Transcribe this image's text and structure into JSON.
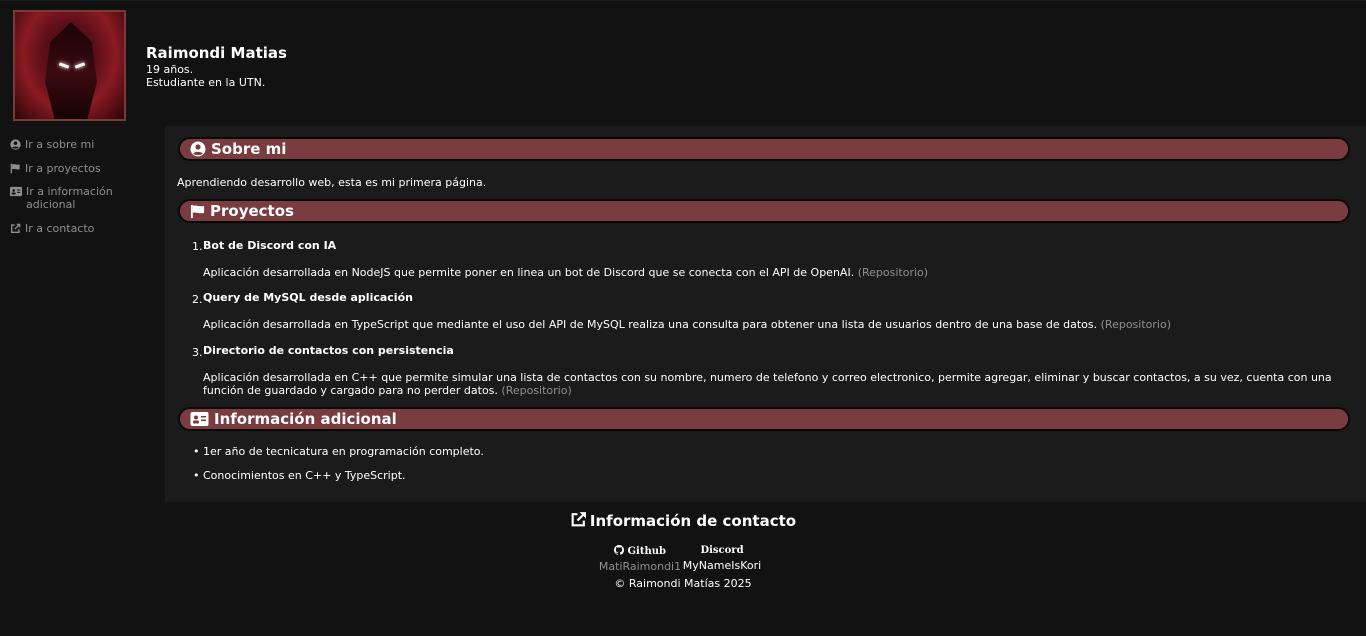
{
  "profile": {
    "name": "Raimondi Matias",
    "age": "19 años.",
    "description": "Estudiante en la UTN."
  },
  "sidebar": {
    "items": [
      {
        "label": "Ir a sobre mi",
        "icon": "user-circle-icon"
      },
      {
        "label": "Ir a proyectos",
        "icon": "flag-icon"
      },
      {
        "label": "Ir a información adicional",
        "icon": "id-card-icon"
      },
      {
        "label": "Ir a contacto",
        "icon": "external-link-icon"
      }
    ]
  },
  "about": {
    "title": "Sobre mi",
    "text": "Aprendiendo desarrollo web, esta es mi primera página."
  },
  "projects": {
    "title": "Proyectos",
    "items": [
      {
        "number": "1.",
        "title": "Bot de Discord con IA",
        "description": "Aplicación desarrollada en NodeJS que permite poner en linea un bot de Discord que se conecta con el API de OpenAI.",
        "link": "(Repositorio)"
      },
      {
        "number": "2.",
        "title": "Query de MySQL desde aplicación",
        "description": "Aplicación desarrollada en TypeScript que mediante el uso del API de MySQL realiza una consulta para obtener una lista de usuarios dentro de una base de datos.",
        "link": "(Repositorio)"
      },
      {
        "number": "3.",
        "title": "Directorio de contactos con persistencia",
        "description": "Aplicación desarrollada en C++ que permite simular una lista de contactos con su nombre, numero de telefono y correo electronico, permite agregar, eliminar y buscar contactos, a su vez, cuenta con una función de guardado y cargado para no perder datos.",
        "link": "(Repositorio)"
      }
    ]
  },
  "additional": {
    "title": "Información adicional",
    "items": [
      "1er año de tecnicatura en programación completo.",
      "Conocimientos en C++ y TypeScript."
    ]
  },
  "contact": {
    "title": "Información de contacto",
    "github_label": "Github",
    "github_value": "MatiRaimondi1",
    "discord_label": "Discord",
    "discord_value": "MyNameIsKori",
    "copyright": "© Raimondi Matías 2025"
  },
  "colors": {
    "section_bar": "#7a3c3f",
    "link_gray": "#8f8f8f"
  }
}
